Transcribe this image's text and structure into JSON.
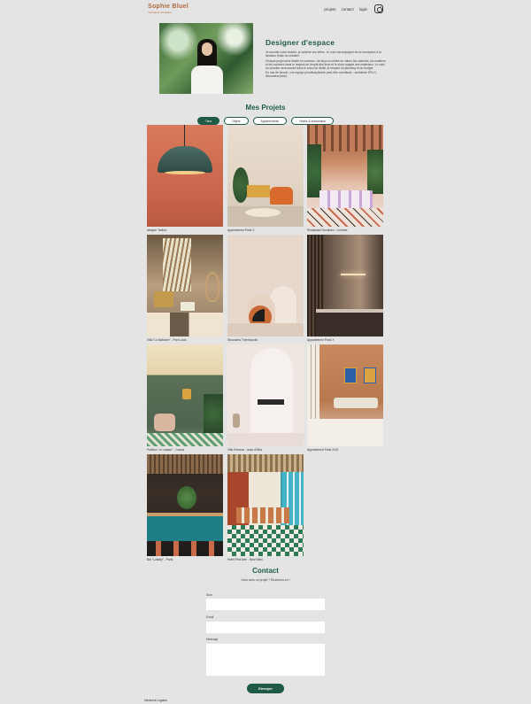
{
  "header": {
    "brand_name": "Sophie Bluel",
    "brand_sub": "Architecte d'intérieur",
    "nav": [
      "projets",
      "contact",
      "login"
    ],
    "instagram_icon": "instagram-icon"
  },
  "intro": {
    "title": "Designer d'espace",
    "paragraphs": [
      "Je raconte votre histoire, je valorise vos idées. Je vous accompagne de la conception à la livraison finale du chantier.",
      "Chaque projet sera étudié en commun, de façon à mettre en valeur les volumes, les matières et les couleurs dans le respect de l'esprit des lieux et le choix adapté des matériaux. Le suivi du chantier sera assuré dans le souci du détail, le respect du planning et du budget.",
      "En cas de besoin, une équipe pluridisciplinaire peut-être constituée : architecte DPLG, décorateur(trice)"
    ]
  },
  "projects": {
    "title": "Mes Projets",
    "filters": [
      "Tous",
      "Objets",
      "Appartements",
      "Hotels & restaurants"
    ],
    "active_filter": "Tous",
    "items": [
      "Abajour Tahina",
      "Appartement Paris V",
      "Restaurant Sushisen - Londres",
      "Villa \"La Balisiere\" - Port Louis",
      "Structures Thermopolis",
      "Appartement Paris X",
      "Pavillon \"Le coteau\" - Cassis",
      "Villa Ferneze - Isola d'Elba",
      "Appartement Paris XVIII",
      "Bar \"Lullaby\" - Paris",
      "Hotel First Arte - New Delhi"
    ]
  },
  "contact": {
    "title": "Contact",
    "subtitle": "Vous avez un projet ? Discutons-en !",
    "name_label": "Nom",
    "email_label": "Email",
    "message_label": "Message",
    "name_value": "",
    "email_value": "",
    "message_value": "",
    "submit_label": "Envoyer"
  },
  "footer": {
    "legal": "Mentions Légales"
  }
}
